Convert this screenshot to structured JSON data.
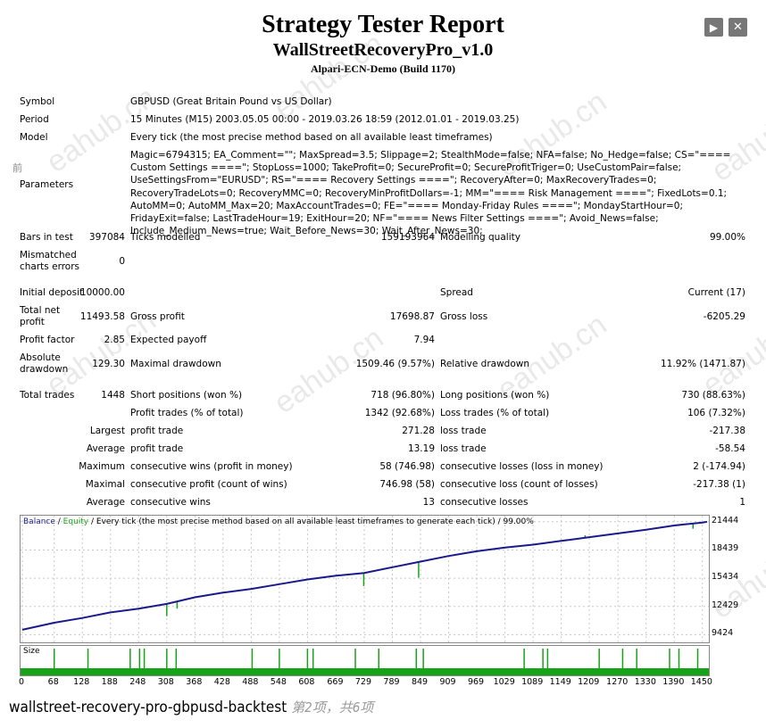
{
  "header": {
    "title": "Strategy Tester Report",
    "subtitle": "WallStreetRecoveryPro_v1.0",
    "server": "Alpari-ECN-Demo (Build 1170)",
    "prev_icon": "▶",
    "close_icon": "✕"
  },
  "side_char": "前",
  "watermark": "eahub.cn",
  "info": {
    "symbol_label": "Symbol",
    "symbol_value": "GBPUSD (Great Britain Pound vs US Dollar)",
    "period_label": "Period",
    "period_value": "15 Minutes (M15) 2003.05.05 00:00 - 2019.03.26 18:59 (2012.01.01 - 2019.03.25)",
    "model_label": "Model",
    "model_value": "Every tick (the most precise method based on all available least timeframes)",
    "parameters_label": "Parameters",
    "parameters_value": "Magic=6794315; EA_Comment=\"\"; MaxSpread=3.5; Slippage=2; StealthMode=false; NFA=false; No_Hedge=false; CS=\"==== Custom Settings ====\"; StopLoss=1000; TakeProfit=0; SecureProfit=0; SecureProfitTriger=0; UseCustomPair=false; UseSettingsFrom=\"EURUSD\"; RS=\"==== Recovery Settings ====\"; RecoveryAfter=0; MaxRecoveryTrades=0; RecoveryTradeLots=0; RecoveryMMC=0; RecoveryMinProfitDollars=-1; MM=\"==== Risk Management ====\"; FixedLots=0.1; AutoMM=0; AutoMM_Max=20; MaxAccountTrades=0; FE=\"==== Monday-Friday Rules ====\"; MondayStartHour=0; FridayExit=false; LastTradeHour=19; ExitHour=20; NF=\"==== News Filter Settings ====\"; Avoid_News=false; Include_Medium_News=true; Wait_Before_News=30; Wait_After_News=30;"
  },
  "stats": {
    "bars_label": "Bars in test",
    "bars_value": "397084",
    "ticks_label": "Ticks modelled",
    "ticks_value": "159193964",
    "quality_label": "Modelling quality",
    "quality_value": "99.00%",
    "mismatch_label_1": "Mismatched",
    "mismatch_label_2": "charts errors",
    "mismatch_value": "0",
    "deposit_label": "Initial deposit",
    "deposit_value": "10000.00",
    "spread_label": "Spread",
    "spread_value": "Current (17)",
    "netprofit_label_1": "Total net",
    "netprofit_label_2": "profit",
    "netprofit_value": "11493.58",
    "grossprofit_label": "Gross profit",
    "grossprofit_value": "17698.87",
    "grossloss_label": "Gross loss",
    "grossloss_value": "-6205.29",
    "pf_label": "Profit factor",
    "pf_value": "2.85",
    "payoff_label": "Expected payoff",
    "payoff_value": "7.94",
    "absdd_label_1": "Absolute",
    "absdd_label_2": "drawdown",
    "absdd_value": "129.30",
    "maxdd_label": "Maximal drawdown",
    "maxdd_value": "1509.46 (9.57%)",
    "reldd_label": "Relative drawdown",
    "reldd_value": "11.92% (1471.87)",
    "trades_label": "Total trades",
    "trades_value": "1448",
    "short_label": "Short positions (won %)",
    "short_value": "718 (96.80%)",
    "long_label": "Long positions (won %)",
    "long_value": "730 (88.63%)",
    "ptrades_label": "Profit trades (% of total)",
    "ptrades_value": "1342 (92.68%)",
    "ltrades_label": "Loss trades (% of total)",
    "ltrades_value": "106 (7.32%)",
    "largest_label": "Largest",
    "largest_profit_label": "profit trade",
    "largest_profit_value": "271.28",
    "largest_loss_label": "loss trade",
    "largest_loss_value": "-217.38",
    "average_label": "Average",
    "average_profit_label": "profit trade",
    "average_profit_value": "13.19",
    "average_loss_label": "loss trade",
    "average_loss_value": "-58.54",
    "maximum_label": "Maximum",
    "maxwins_label": "consecutive wins (profit in money)",
    "maxwins_value": "58 (746.98)",
    "maxlosses_label": "consecutive losses (loss in money)",
    "maxlosses_value": "2 (-174.94)",
    "maximal_label": "Maximal",
    "maxprofit_label": "consecutive profit (count of wins)",
    "maxprofit_value": "746.98 (58)",
    "maxloss_label": "consecutive loss (count of losses)",
    "maxloss_value": "-217.38 (1)",
    "average2_label": "Average",
    "avgwins_label": "consecutive wins",
    "avgwins_value": "13",
    "avglosses_label": "consecutive losses",
    "avglosses_value": "1"
  },
  "chart_data": {
    "type": "line",
    "legend_balance": "Balance",
    "legend_sep": " / ",
    "legend_equity": "Equity",
    "legend_rest": " / Every tick (the most precise method based on all available least timeframes to generate each tick) / 99.00%",
    "y_ticks": [
      "21444",
      "18439",
      "15434",
      "12429",
      "9424"
    ],
    "y_tick_values": [
      21444,
      18439,
      15434,
      12429,
      9424
    ],
    "x_ticks": [
      "0",
      "68",
      "128",
      "188",
      "248",
      "308",
      "368",
      "428",
      "488",
      "548",
      "608",
      "669",
      "729",
      "789",
      "849",
      "909",
      "969",
      "1029",
      "1089",
      "1149",
      "1209",
      "1270",
      "1330",
      "1390",
      "1450"
    ],
    "xlim": [
      0,
      1460
    ],
    "ylim": [
      8800,
      21900
    ],
    "series": [
      {
        "name": "Balance",
        "color": "#1a1a8c",
        "x": [
          0,
          68,
          128,
          188,
          248,
          308,
          368,
          428,
          488,
          548,
          608,
          669,
          729,
          789,
          849,
          909,
          969,
          1029,
          1089,
          1149,
          1209,
          1270,
          1330,
          1390,
          1450,
          1460
        ],
        "y": [
          9950,
          10700,
          11200,
          11800,
          12200,
          12700,
          13400,
          13900,
          14300,
          14800,
          15300,
          15700,
          16000,
          16600,
          17200,
          17800,
          18300,
          18700,
          19000,
          19400,
          19800,
          20200,
          20600,
          21050,
          21360,
          21444
        ]
      },
      {
        "name": "Equity",
        "color": "#17a317",
        "dips": [
          [
            308,
            11400
          ],
          [
            330,
            12200
          ],
          [
            728,
            14600
          ],
          [
            845,
            15500
          ],
          [
            1200,
            20000
          ],
          [
            1290,
            20300
          ],
          [
            1430,
            20700
          ]
        ]
      }
    ],
    "size_label": "Size",
    "size_spikes": [
      68,
      140,
      230,
      250,
      260,
      308,
      328,
      490,
      548,
      608,
      620,
      710,
      760,
      840,
      855,
      1070,
      1110,
      1120,
      1230,
      1280,
      1310,
      1380,
      1400,
      1440
    ]
  },
  "caption": {
    "title": "wallstreet-recovery-pro-gbpusd-backtest",
    "count": "第2项，共6项"
  }
}
